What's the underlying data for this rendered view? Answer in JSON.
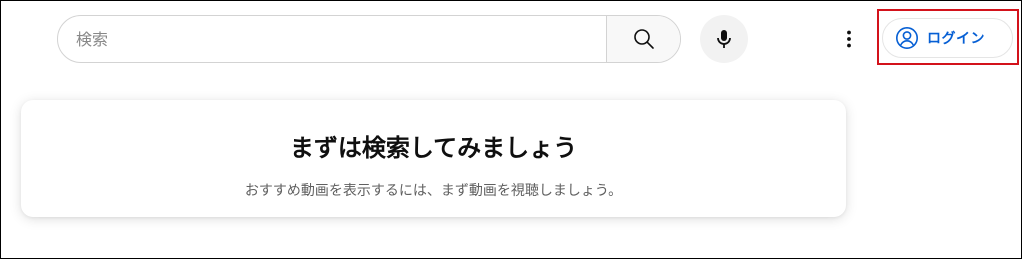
{
  "header": {
    "search": {
      "placeholder": "検索",
      "value": ""
    },
    "search_button_icon": "search-icon",
    "mic_button_icon": "microphone-icon",
    "more_button_icon": "more-vert-icon",
    "login": {
      "label": "ログイン",
      "icon": "account-circle-icon",
      "color": "#065fd4"
    },
    "highlight_color": "#d3121b"
  },
  "prompt": {
    "title": "まずは検索してみましょう",
    "subtitle": "おすすめ動画を表示するには、まず動画を視聴しましょう。"
  }
}
